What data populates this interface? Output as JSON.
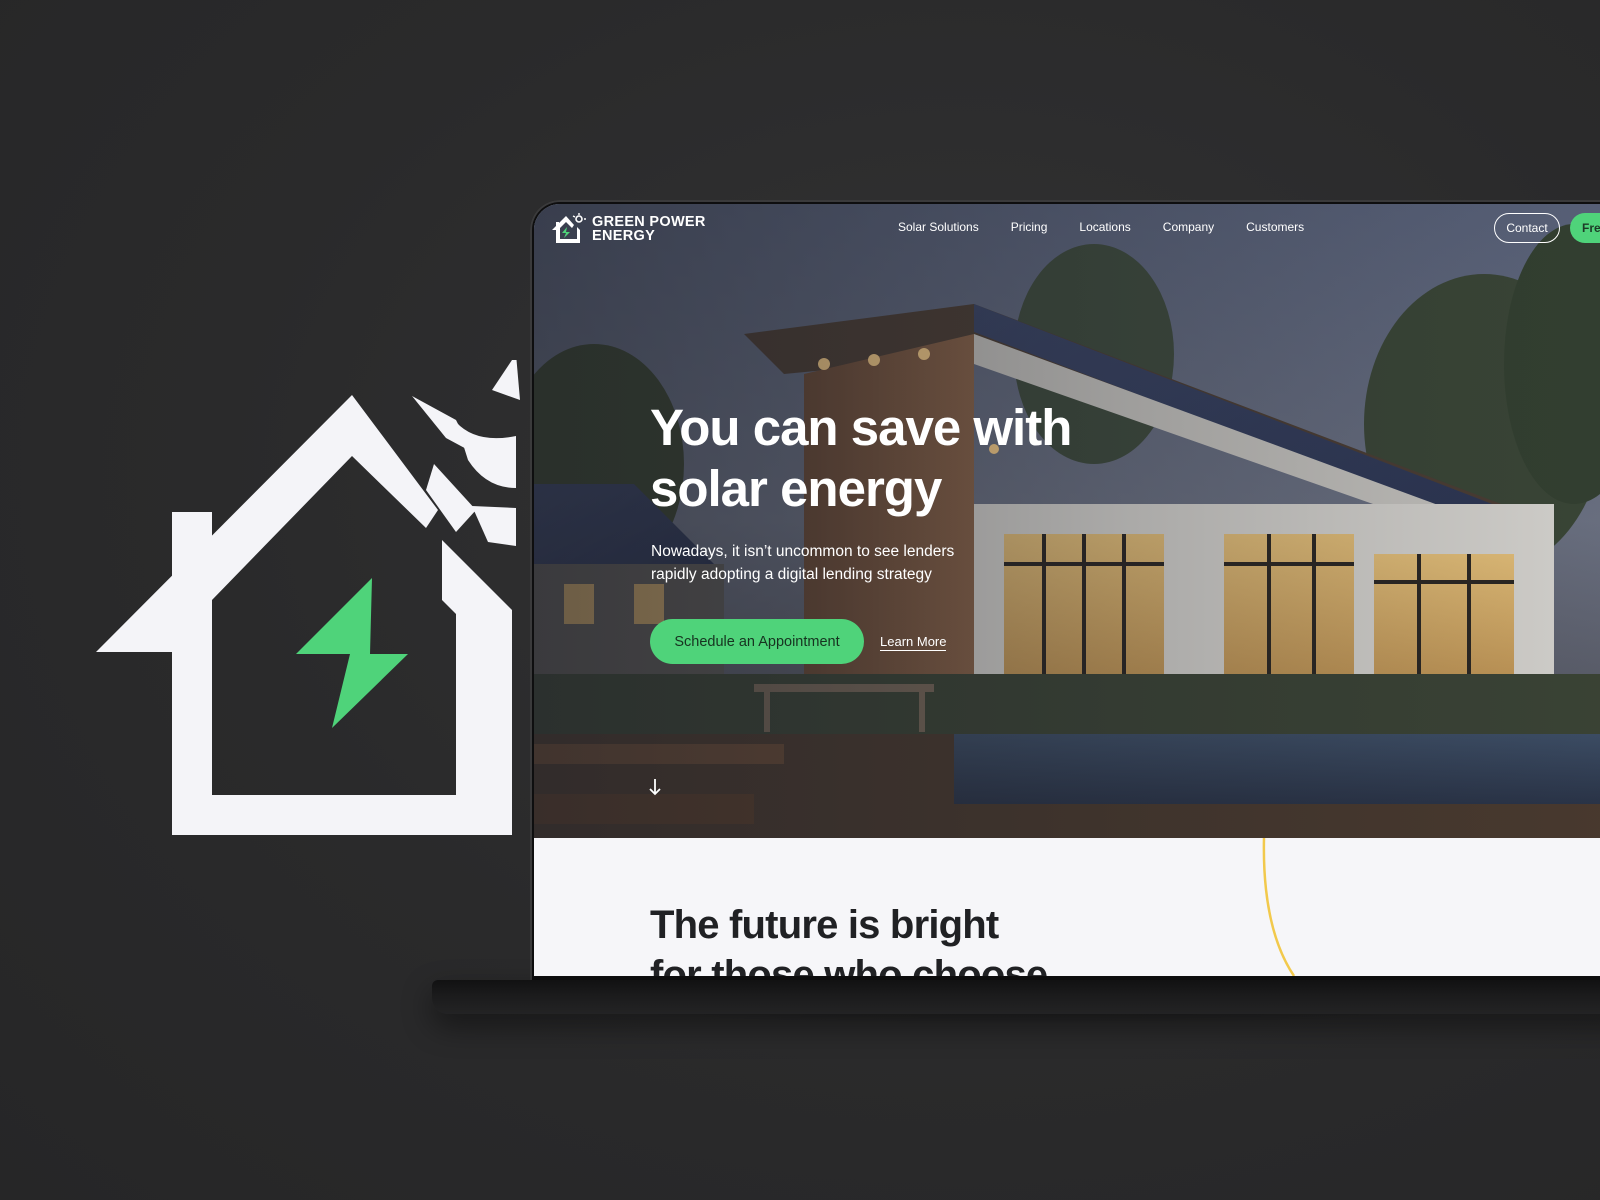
{
  "brand": {
    "name_line1": "GREEN POWER",
    "name_line2": "ENERGY",
    "accent_color": "#4fd37a",
    "logo_icon": "house-sun-bolt-icon"
  },
  "nav": {
    "links": [
      "Solar Solutions",
      "Pricing",
      "Locations",
      "Company",
      "Customers"
    ],
    "contact_label": "Contact",
    "cta_label": "Free"
  },
  "hero": {
    "title_line1": "You can save with",
    "title_line2": "solar energy",
    "subtitle_line1": "Nowadays, it isn’t uncommon to see lenders",
    "subtitle_line2": "rapidly adopting a digital lending strategy",
    "primary_button": "Schedule an Appointment",
    "secondary_link": "Learn More",
    "scroll_icon": "arrow-down-icon"
  },
  "section2": {
    "title_line1": "The future is bright",
    "title_line2": "for those who choose",
    "decor_color": "#f2c94c"
  }
}
